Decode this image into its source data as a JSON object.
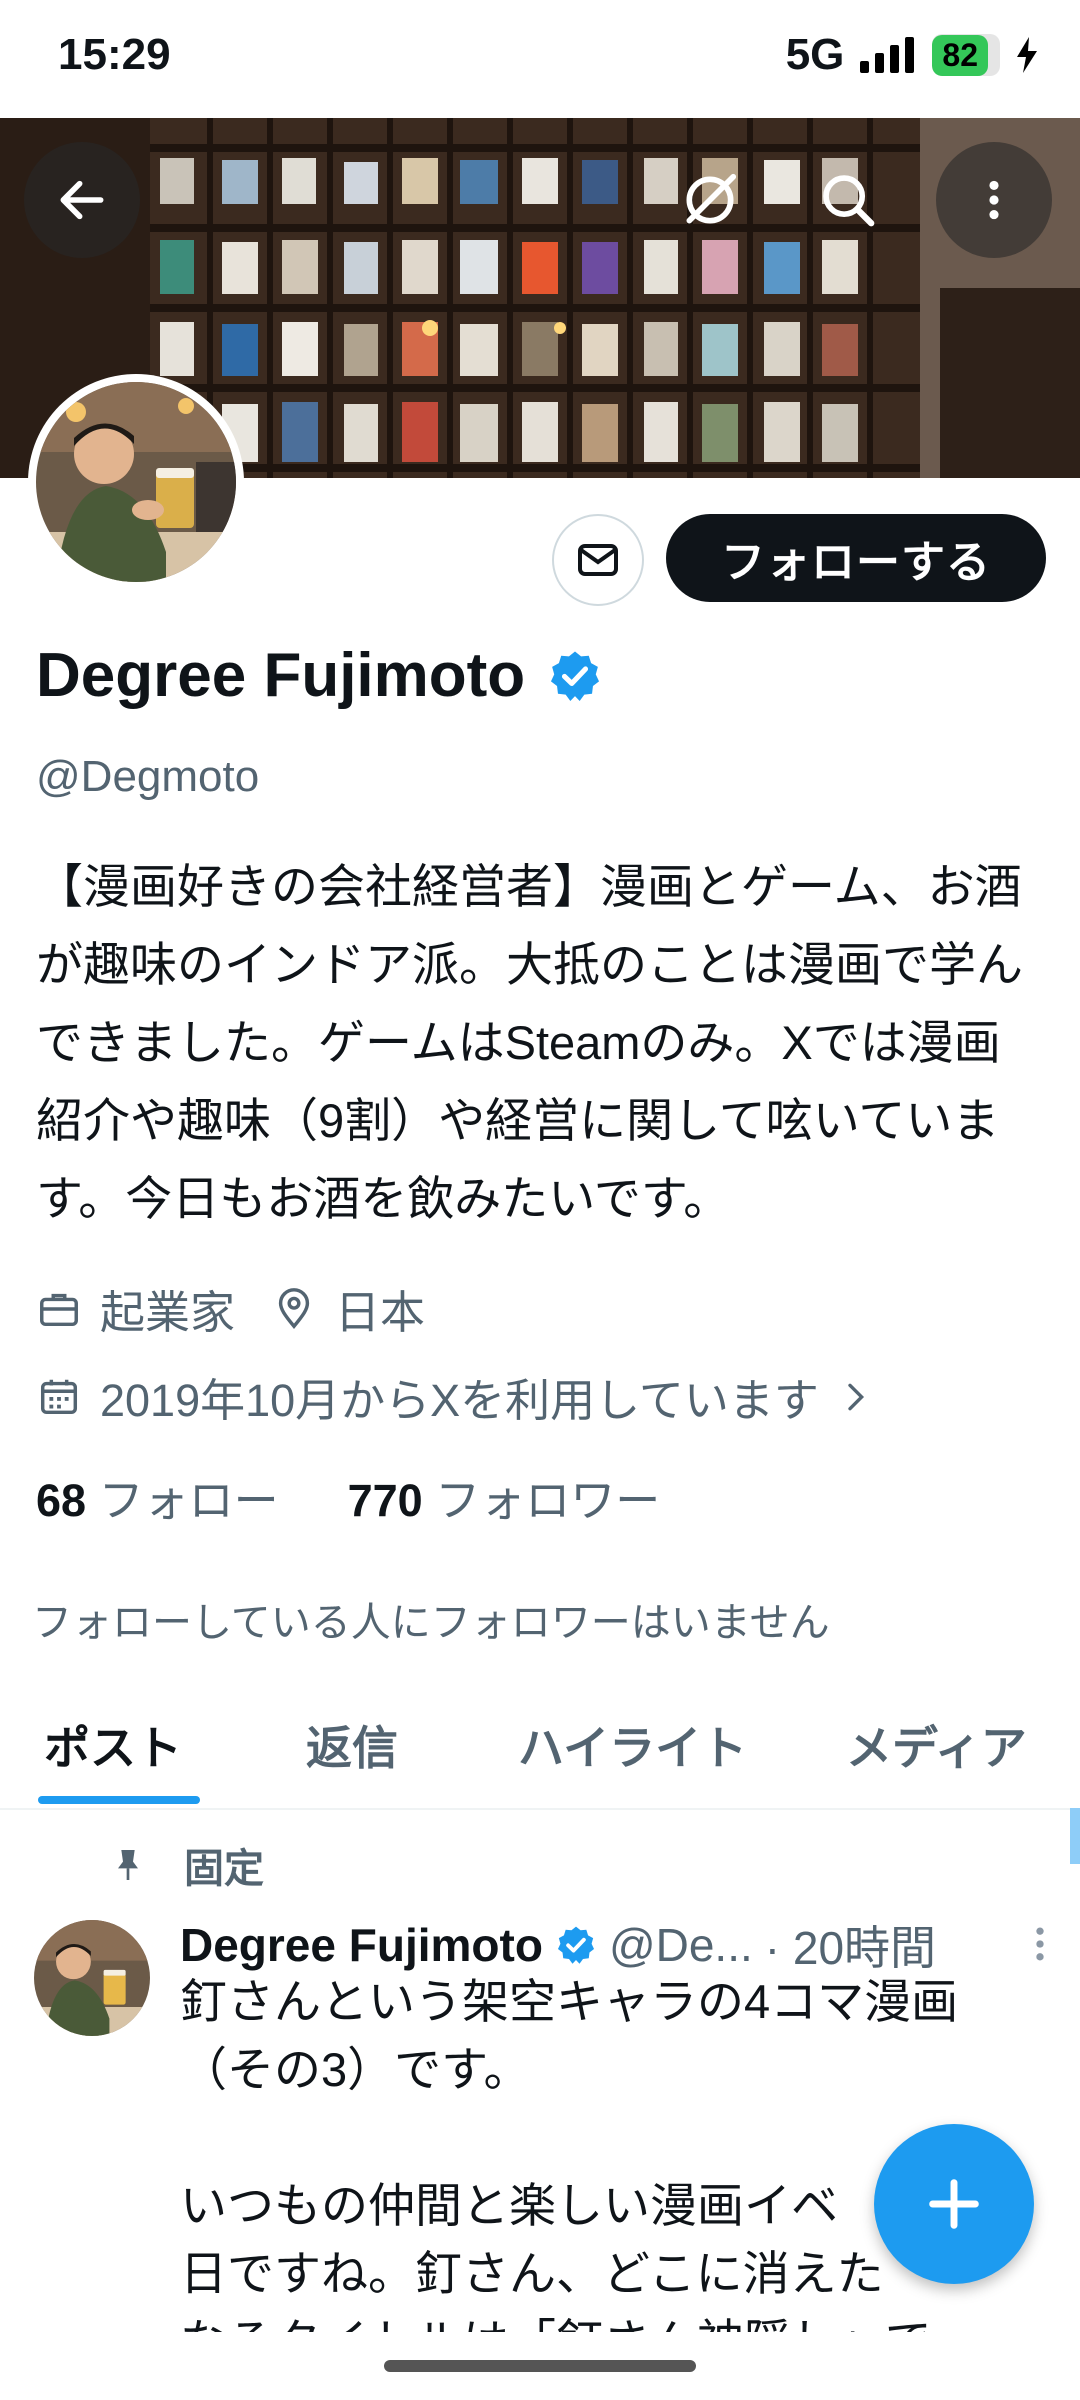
{
  "status_bar": {
    "time": "15:29",
    "network": "5G",
    "battery": "82"
  },
  "profile": {
    "name": "Degree Fujimoto",
    "handle": "@Degmoto",
    "bio": "【漫画好きの会社経営者】漫画とゲーム、お酒が趣味のインドア派。大抵のことは漫画で学んできました。ゲームはSteamのみ。Xでは漫画紹介や趣味（9割）や経営に関して呟いています。今日もお酒を飲みたいです。",
    "occupation": "起業家",
    "location": "日本",
    "joined": "2019年10月からXを利用しています",
    "following_count": "68",
    "following_label": "フォロー",
    "followers_count": "770",
    "followers_label": "フォロワー",
    "mutual_note": "フォローしている人にフォロワーはいません"
  },
  "actions": {
    "follow_label": "フォローする"
  },
  "tabs": [
    {
      "label": "ポスト",
      "active": true
    },
    {
      "label": "返信"
    },
    {
      "label": "ハイライト"
    },
    {
      "label": "メディア"
    }
  ],
  "pinned_post": {
    "pinned_label": "固定",
    "author": "Degree Fujimoto",
    "handle": "@De...",
    "time": "· 20時間",
    "text": "釘さんという架空キャラの4コマ漫画（その3）です。\n\nいつもの仲間と楽しい漫画イベ\n日ですね。釘さん、どこに消えた\nなるタイトルは「釘さん神隠し」で"
  },
  "icons": {
    "back": "arrow-left-icon",
    "grok": "grok-icon",
    "search": "search-icon",
    "more": "more-vertical-icon",
    "message": "mail-icon",
    "verified": "verified-badge-icon",
    "briefcase": "briefcase-icon",
    "location": "location-pin-icon",
    "calendar": "calendar-icon",
    "chevron": "chevron-right-icon",
    "pin": "pin-icon",
    "compose": "plus-icon"
  },
  "colors": {
    "accent": "#1d9bf0",
    "text": "#0f1419",
    "muted": "#536471",
    "follow_bg": "#0f1419"
  }
}
